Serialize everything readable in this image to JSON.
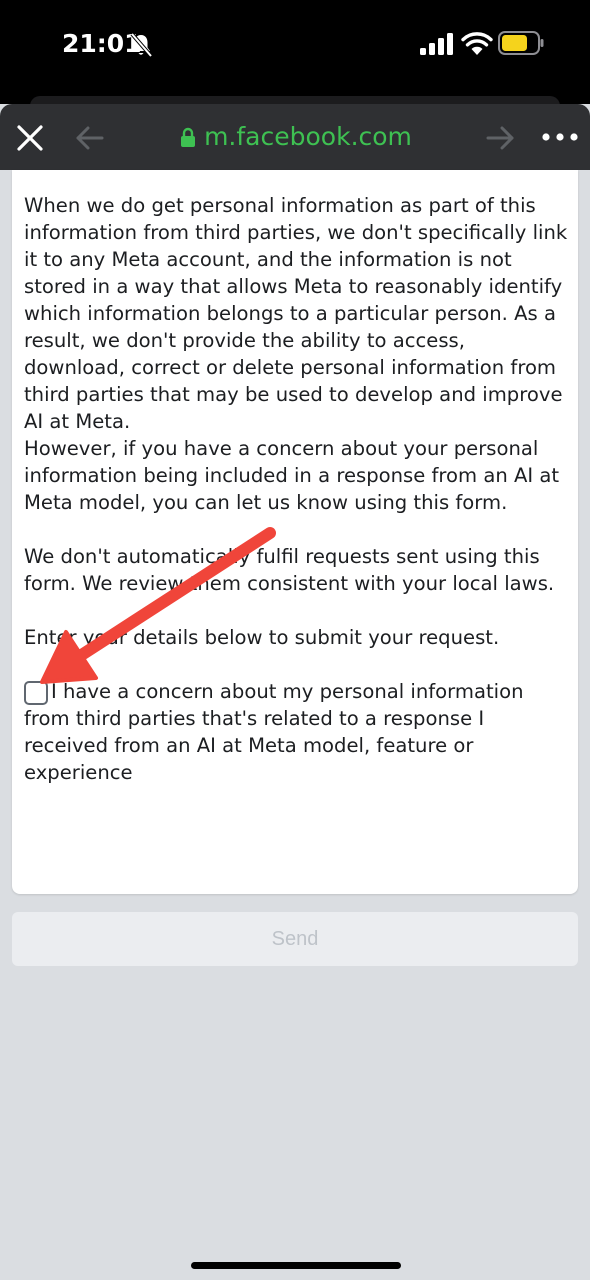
{
  "status_bar": {
    "time": "21:01",
    "icons": [
      "bell-slash-icon",
      "signal-icon",
      "wifi-icon",
      "battery-icon"
    ]
  },
  "browser": {
    "url": "m.facebook.com",
    "icons": [
      "close-icon",
      "back-icon",
      "lock-icon",
      "forward-icon",
      "more-icon"
    ]
  },
  "content": {
    "paragraphs": [
      "When we do get personal information as part of this information from third parties, we don't specifically link it to any Meta account, and the information is not stored in a way that allows Meta to reasonably identify which information belongs to a particular person. As a result, we don't provide the ability to access, download, correct or delete personal information from third parties that may be used to develop and improve AI at Meta.",
      "However, if you have a concern about your personal information being included in a response from an AI at Meta model, you can let us know using this form.",
      "We don't automatically fulfil requests sent using this form. We review them consistent with your local laws.",
      "Enter your details below to submit your request."
    ],
    "consent_label": "I have a concern about my personal information from third parties that's related to a response I received from an AI at Meta model, feature or experience",
    "consent_checked": false
  },
  "form": {
    "send_label": "Send"
  },
  "colors": {
    "url_green": "#3ec152",
    "toolbar": "#2f3033",
    "arrow_red": "#f0453a",
    "page_bg": "#dadde1"
  }
}
